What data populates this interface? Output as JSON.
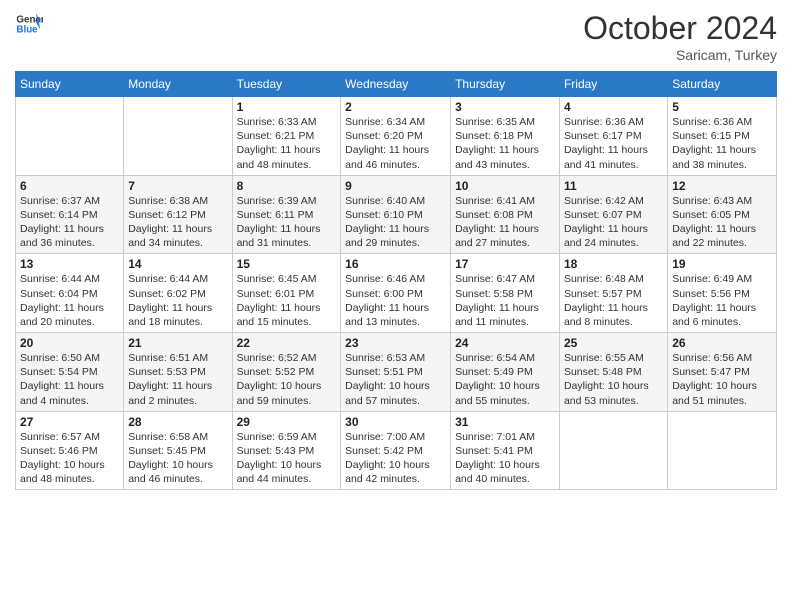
{
  "logo": {
    "line1": "General",
    "line2": "Blue"
  },
  "title": "October 2024",
  "location": "Saricam, Turkey",
  "days_header": [
    "Sunday",
    "Monday",
    "Tuesday",
    "Wednesday",
    "Thursday",
    "Friday",
    "Saturday"
  ],
  "weeks": [
    [
      {
        "day": "",
        "info": ""
      },
      {
        "day": "",
        "info": ""
      },
      {
        "day": "1",
        "info": "Sunrise: 6:33 AM\nSunset: 6:21 PM\nDaylight: 11 hours and 48 minutes."
      },
      {
        "day": "2",
        "info": "Sunrise: 6:34 AM\nSunset: 6:20 PM\nDaylight: 11 hours and 46 minutes."
      },
      {
        "day": "3",
        "info": "Sunrise: 6:35 AM\nSunset: 6:18 PM\nDaylight: 11 hours and 43 minutes."
      },
      {
        "day": "4",
        "info": "Sunrise: 6:36 AM\nSunset: 6:17 PM\nDaylight: 11 hours and 41 minutes."
      },
      {
        "day": "5",
        "info": "Sunrise: 6:36 AM\nSunset: 6:15 PM\nDaylight: 11 hours and 38 minutes."
      }
    ],
    [
      {
        "day": "6",
        "info": "Sunrise: 6:37 AM\nSunset: 6:14 PM\nDaylight: 11 hours and 36 minutes."
      },
      {
        "day": "7",
        "info": "Sunrise: 6:38 AM\nSunset: 6:12 PM\nDaylight: 11 hours and 34 minutes."
      },
      {
        "day": "8",
        "info": "Sunrise: 6:39 AM\nSunset: 6:11 PM\nDaylight: 11 hours and 31 minutes."
      },
      {
        "day": "9",
        "info": "Sunrise: 6:40 AM\nSunset: 6:10 PM\nDaylight: 11 hours and 29 minutes."
      },
      {
        "day": "10",
        "info": "Sunrise: 6:41 AM\nSunset: 6:08 PM\nDaylight: 11 hours and 27 minutes."
      },
      {
        "day": "11",
        "info": "Sunrise: 6:42 AM\nSunset: 6:07 PM\nDaylight: 11 hours and 24 minutes."
      },
      {
        "day": "12",
        "info": "Sunrise: 6:43 AM\nSunset: 6:05 PM\nDaylight: 11 hours and 22 minutes."
      }
    ],
    [
      {
        "day": "13",
        "info": "Sunrise: 6:44 AM\nSunset: 6:04 PM\nDaylight: 11 hours and 20 minutes."
      },
      {
        "day": "14",
        "info": "Sunrise: 6:44 AM\nSunset: 6:02 PM\nDaylight: 11 hours and 18 minutes."
      },
      {
        "day": "15",
        "info": "Sunrise: 6:45 AM\nSunset: 6:01 PM\nDaylight: 11 hours and 15 minutes."
      },
      {
        "day": "16",
        "info": "Sunrise: 6:46 AM\nSunset: 6:00 PM\nDaylight: 11 hours and 13 minutes."
      },
      {
        "day": "17",
        "info": "Sunrise: 6:47 AM\nSunset: 5:58 PM\nDaylight: 11 hours and 11 minutes."
      },
      {
        "day": "18",
        "info": "Sunrise: 6:48 AM\nSunset: 5:57 PM\nDaylight: 11 hours and 8 minutes."
      },
      {
        "day": "19",
        "info": "Sunrise: 6:49 AM\nSunset: 5:56 PM\nDaylight: 11 hours and 6 minutes."
      }
    ],
    [
      {
        "day": "20",
        "info": "Sunrise: 6:50 AM\nSunset: 5:54 PM\nDaylight: 11 hours and 4 minutes."
      },
      {
        "day": "21",
        "info": "Sunrise: 6:51 AM\nSunset: 5:53 PM\nDaylight: 11 hours and 2 minutes."
      },
      {
        "day": "22",
        "info": "Sunrise: 6:52 AM\nSunset: 5:52 PM\nDaylight: 10 hours and 59 minutes."
      },
      {
        "day": "23",
        "info": "Sunrise: 6:53 AM\nSunset: 5:51 PM\nDaylight: 10 hours and 57 minutes."
      },
      {
        "day": "24",
        "info": "Sunrise: 6:54 AM\nSunset: 5:49 PM\nDaylight: 10 hours and 55 minutes."
      },
      {
        "day": "25",
        "info": "Sunrise: 6:55 AM\nSunset: 5:48 PM\nDaylight: 10 hours and 53 minutes."
      },
      {
        "day": "26",
        "info": "Sunrise: 6:56 AM\nSunset: 5:47 PM\nDaylight: 10 hours and 51 minutes."
      }
    ],
    [
      {
        "day": "27",
        "info": "Sunrise: 6:57 AM\nSunset: 5:46 PM\nDaylight: 10 hours and 48 minutes."
      },
      {
        "day": "28",
        "info": "Sunrise: 6:58 AM\nSunset: 5:45 PM\nDaylight: 10 hours and 46 minutes."
      },
      {
        "day": "29",
        "info": "Sunrise: 6:59 AM\nSunset: 5:43 PM\nDaylight: 10 hours and 44 minutes."
      },
      {
        "day": "30",
        "info": "Sunrise: 7:00 AM\nSunset: 5:42 PM\nDaylight: 10 hours and 42 minutes."
      },
      {
        "day": "31",
        "info": "Sunrise: 7:01 AM\nSunset: 5:41 PM\nDaylight: 10 hours and 40 minutes."
      },
      {
        "day": "",
        "info": ""
      },
      {
        "day": "",
        "info": ""
      }
    ]
  ]
}
